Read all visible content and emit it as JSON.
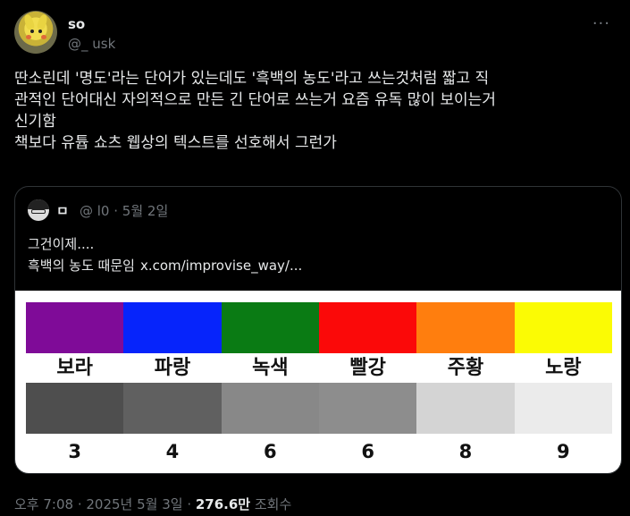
{
  "author": {
    "name": "so",
    "handle": "@_          usk"
  },
  "more_label": "···",
  "tweet_lines": [
    "딴소린데 '명도'라는 단어가 있는데도 '흑백의 농도'라고 쓰는것처럼 짧고 직",
    "관적인 단어대신 자의적으로 만든 긴 단어로 쓰는거 요즘 유독 많이 보이는거",
    "신기함",
    "책보다 유튭 쇼츠 웹상의 텍스트를 선호해서 그런가"
  ],
  "quote": {
    "name": "ㅁ",
    "meta": "@               l0 · 5월 2일",
    "line1": "그건이제....",
    "line2": "흑백의 농도 때문임",
    "link": "x.com/improvise_way/..."
  },
  "figure": {
    "colors": [
      {
        "label": "보라",
        "hex": "#7f0b98"
      },
      {
        "label": "파랑",
        "hex": "#0624fb"
      },
      {
        "label": "녹색",
        "hex": "#0a7b14"
      },
      {
        "label": "빨강",
        "hex": "#fb0909"
      },
      {
        "label": "주황",
        "hex": "#ff7e0e"
      },
      {
        "label": "노랑",
        "hex": "#fbfb04"
      }
    ],
    "grays": [
      {
        "value": "3",
        "hex": "#4e4e4e"
      },
      {
        "value": "4",
        "hex": "#606060"
      },
      {
        "value": "6",
        "hex": "#888888"
      },
      {
        "value": "6",
        "hex": "#8d8d8d"
      },
      {
        "value": "8",
        "hex": "#d4d4d4"
      },
      {
        "value": "9",
        "hex": "#ebebeb"
      }
    ]
  },
  "footer": {
    "time": "오후 7:08 · 2025년 5월 3일 · ",
    "views": "276.6만",
    "views_label": " 조회수"
  }
}
